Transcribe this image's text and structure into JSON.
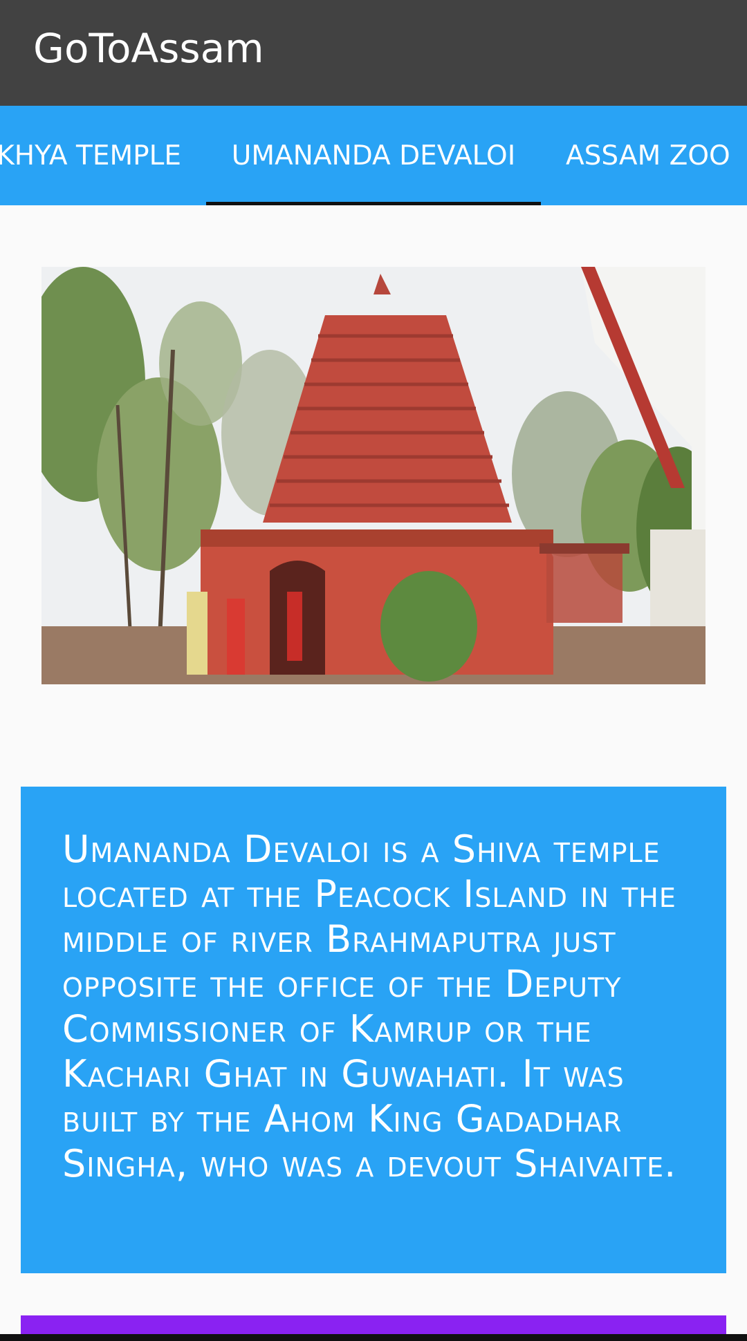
{
  "app": {
    "title": "GoToAssam"
  },
  "tabs": [
    {
      "label": "KHYA TEMPLE",
      "selected": false
    },
    {
      "label": "UMANANDA DEVALOI",
      "selected": true
    },
    {
      "label": "ASSAM ZOO",
      "selected": false
    }
  ],
  "content": {
    "description": "Umananda Devaloi is a Shiva temple located at the Peacock Island in the middle of river Brahmaputra just opposite the office of the Deputy Commissioner of Kamrup or the Kachari Ghat in Guwahati. It was built by the Ahom King Gadadhar Singha, who was a devout Shaivaite."
  },
  "colors": {
    "appbar": "#424242",
    "tabbar": "#29a3f5",
    "indicator": "#111111",
    "card": "#29a3f5",
    "next_card": "#8a22f2",
    "background": "#fafafa"
  }
}
